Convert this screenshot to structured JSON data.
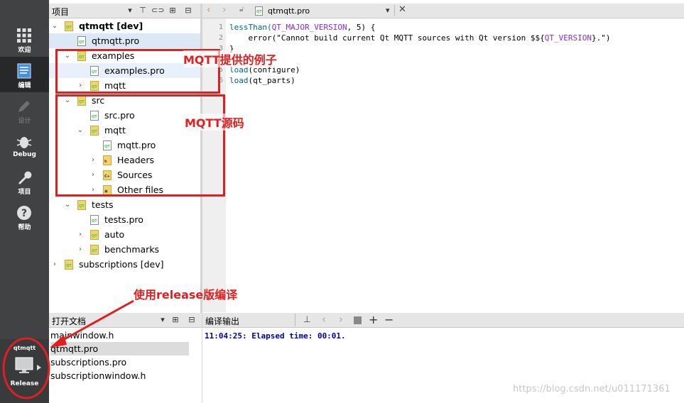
{
  "mode_bar": {
    "items": [
      {
        "label": "欢迎",
        "icon": "grid-icon"
      },
      {
        "label": "编辑",
        "icon": "edit-document-icon"
      },
      {
        "label": "设计",
        "icon": "pencil-icon"
      },
      {
        "label": "Debug",
        "icon": "bug-icon"
      },
      {
        "label": "项目",
        "icon": "wrench-icon"
      },
      {
        "label": "帮助",
        "icon": "help-icon"
      }
    ],
    "kit": {
      "project": "qtmqtt",
      "build": "Release"
    }
  },
  "project_pane": {
    "title": "项目",
    "tree": [
      {
        "label": "qtmqtt [dev]",
        "expanded": true
      },
      {
        "label": "qtmqtt.pro"
      },
      {
        "label": "examples",
        "expanded": true
      },
      {
        "label": "examples.pro"
      },
      {
        "label": "mqtt",
        "expanded": false
      },
      {
        "label": "src",
        "expanded": true
      },
      {
        "label": "src.pro"
      },
      {
        "label": "mqtt",
        "expanded": true
      },
      {
        "label": "mqtt.pro"
      },
      {
        "label": "Headers",
        "expanded": false
      },
      {
        "label": "Sources",
        "expanded": false
      },
      {
        "label": "Other files",
        "expanded": false
      },
      {
        "label": "tests",
        "expanded": true
      },
      {
        "label": "tests.pro"
      },
      {
        "label": "auto",
        "expanded": false
      },
      {
        "label": "benchmarks",
        "expanded": false
      },
      {
        "label": "subscriptions [dev]",
        "expanded": false
      }
    ]
  },
  "editor": {
    "filename": "qtmqtt.pro",
    "line_numbers": [
      "1",
      "2",
      "3",
      "4",
      "5",
      "6"
    ],
    "lines": {
      "l1a": "lessThan(",
      "l1b": "QT_MAJOR_VERSION",
      "l1c": ", 5) {",
      "l2a": "    error(\"Cannot build current Qt MQTT sources with Qt version $${",
      "l2b": "QT_VERSION",
      "l2c": "}.\")",
      "l3": "}",
      "l5a": "load",
      "l5b": "(configure)",
      "l6a": "load",
      "l6b": "(qt_parts)"
    }
  },
  "open_docs": {
    "title": "打开文档",
    "items": [
      "mainwindow.h",
      "qtmqtt.pro",
      "subscriptions.pro",
      "subscriptionwindow.h"
    ]
  },
  "output": {
    "title": "编译输出",
    "text": "11:04:25: Elapsed time: 00:01."
  },
  "watermark": "https://blog.csdn.net/u011171361",
  "annotations": {
    "examples": "MQTT提供的例子",
    "source": "MQTT源码",
    "release": "使用release版编译"
  },
  "colors": {
    "accent_red": "#e02020",
    "modebar": "#404244"
  }
}
